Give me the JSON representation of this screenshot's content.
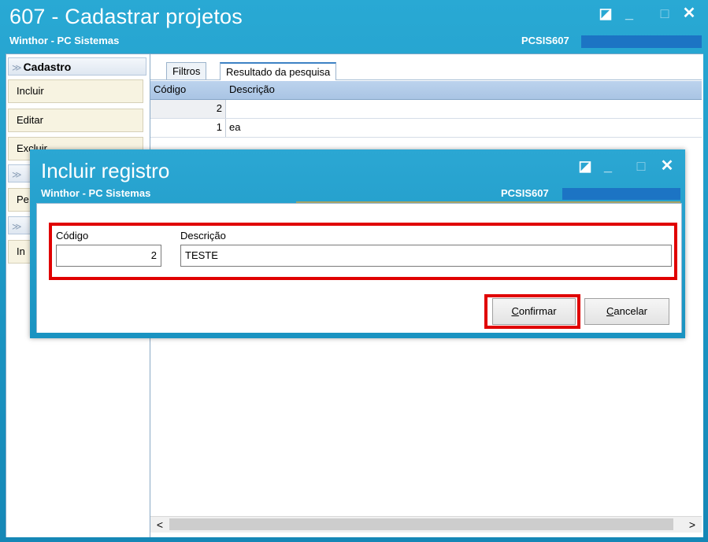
{
  "window": {
    "title": "607 - Cadastrar projetos",
    "subtitle": "Winthor - PC Sistemas",
    "code": "PCSIS607",
    "controls": {
      "restore": "◪",
      "minimize": "_",
      "maximize": "□",
      "close": "✕"
    }
  },
  "sidebar": {
    "groups": [
      {
        "label": "Cadastro",
        "items": [
          "Incluir",
          "Editar",
          "Excluir"
        ]
      },
      {
        "label": "",
        "items": [
          "Pe"
        ]
      },
      {
        "label": "",
        "items": [
          "In"
        ]
      }
    ],
    "chevron": "≫"
  },
  "tabs": [
    {
      "label": "Filtros"
    },
    {
      "label": "Resultado da pesquisa"
    }
  ],
  "grid": {
    "columns": [
      "Código",
      "Descrição"
    ],
    "rows": [
      {
        "codigo": "2",
        "descricao": ""
      },
      {
        "codigo": "1",
        "descricao": "ea"
      }
    ]
  },
  "scroll": {
    "left": "<",
    "right": ">"
  },
  "dialog": {
    "title": "Incluir registro",
    "subtitle": "Winthor - PC Sistemas",
    "code": "PCSIS607",
    "fields": {
      "codigo_label": "Código",
      "codigo_value": "2",
      "descricao_label": "Descrição",
      "descricao_value": "TESTE"
    },
    "buttons": {
      "confirm_prefix": "C",
      "confirm_rest": "onfirmar",
      "cancel_prefix": "C",
      "cancel_rest": "ancelar"
    }
  },
  "colors": {
    "titlebar": "#1b94c2",
    "highlight": "#e00000",
    "grid_header": "#a9c4e4",
    "sidebar_item": "#f7f3e1"
  }
}
